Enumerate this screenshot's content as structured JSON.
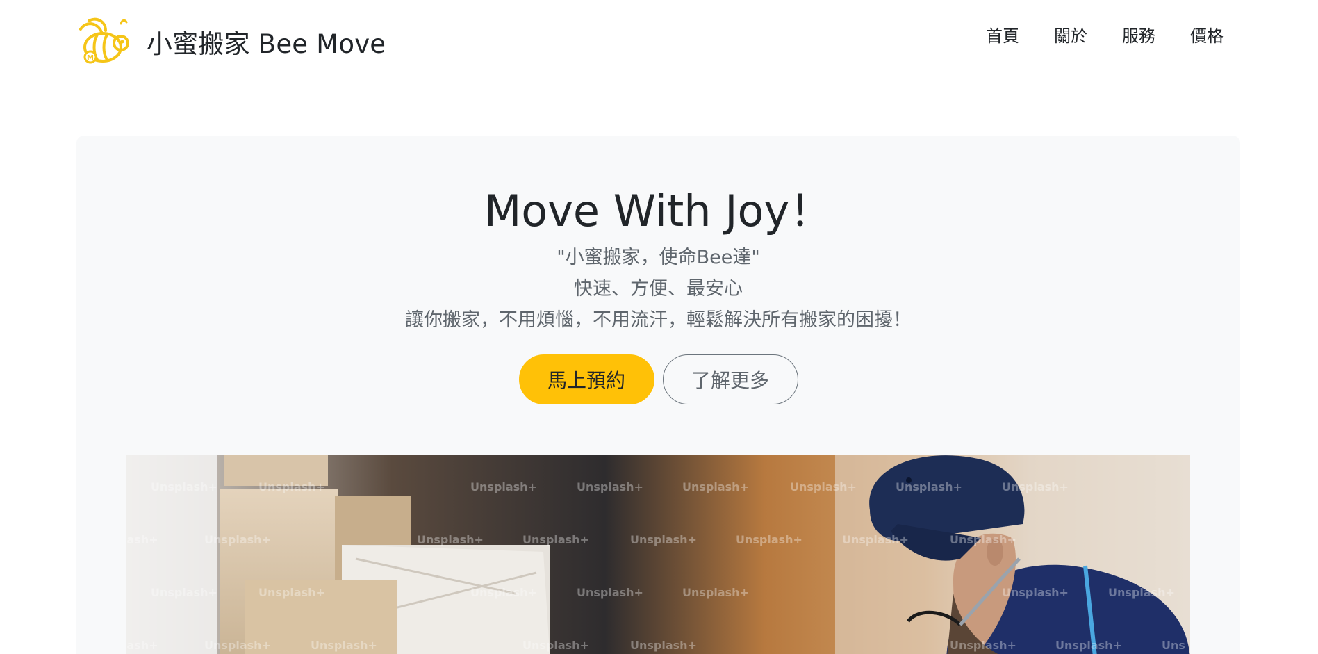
{
  "brand": {
    "logo_icon": "bee-logo-icon",
    "name": "小蜜搬家 Bee Move"
  },
  "nav": {
    "items": [
      {
        "label": "首頁"
      },
      {
        "label": "關於"
      },
      {
        "label": "服務"
      },
      {
        "label": "價格"
      }
    ]
  },
  "hero": {
    "title": "Move With Joy！",
    "lead_lines": [
      "\"小蜜搬家，使命Bee達\"",
      "快速、方便、最安心",
      "讓你搬家，不用煩惱，不用流汗，輕鬆解決所有搬家的困擾！"
    ],
    "primary_button": "馬上預約",
    "secondary_button": "了解更多",
    "image": {
      "description_icon": "mover-photo",
      "watermark": "Unsplash+"
    }
  },
  "colors": {
    "accent": "#ffc107",
    "hero_background": "#f8f9fa",
    "muted_text": "#6c757d"
  }
}
